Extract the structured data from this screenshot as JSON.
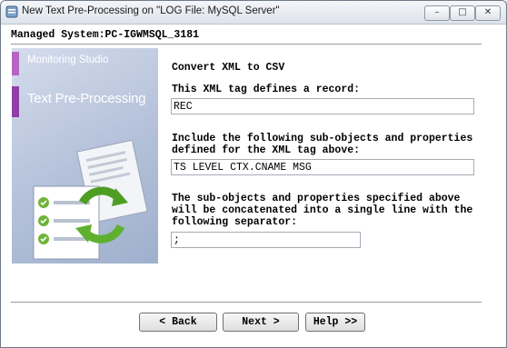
{
  "window": {
    "title": "New Text Pre-Processing on \"LOG File: MySQL Server\"",
    "minimize_glyph": "–",
    "maximize_glyph": "□",
    "close_glyph": "✕"
  },
  "managed_system": "Managed System:PC-IGWMSQL_3181",
  "banner": {
    "product": "Monitoring Studio",
    "heading": "Text Pre-Processing"
  },
  "form": {
    "mode_title": "Convert XML to CSV",
    "record_tag_label": "This XML tag defines a record:",
    "record_tag_value": "REC",
    "subobjects_label": "Include the following sub-objects and properties\ndefined for the XML tag above:",
    "subobjects_value": "TS LEVEL CTX.CNAME MSG",
    "separator_label": "The sub-objects and properties specified above\nwill be concatenated into a single line with the\nfollowing separator:",
    "separator_value": ";"
  },
  "buttons": {
    "back": "< Back",
    "next": "Next >",
    "help": "Help >>"
  }
}
